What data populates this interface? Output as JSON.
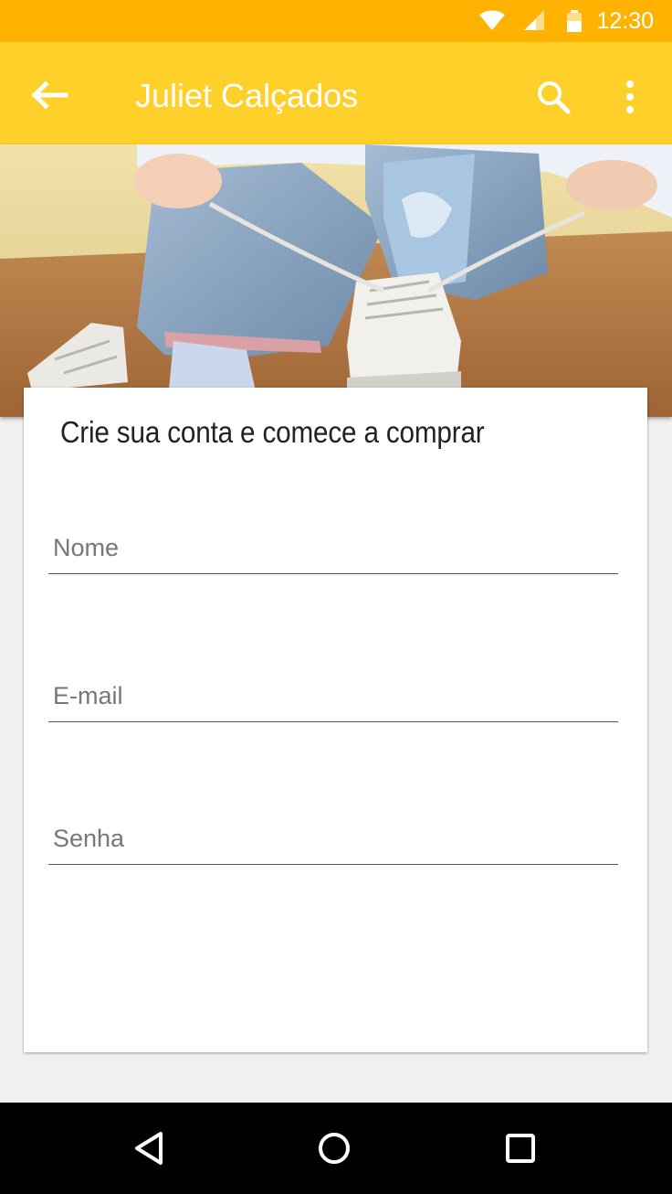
{
  "status_bar": {
    "time": "12:30",
    "icons": [
      "wifi-icon",
      "signal-icon",
      "battery-icon"
    ]
  },
  "app_bar": {
    "title": "Juliet Calçados",
    "actions": [
      "back-arrow-icon",
      "search-icon",
      "more-vert-icon"
    ],
    "color": "#ffd02a"
  },
  "form": {
    "title": "Crie sua conta e comece a comprar",
    "name_placeholder": "Nome",
    "email_placeholder": "E-mail",
    "password_placeholder": "Senha"
  },
  "nav_bar": {
    "icons": [
      "back-triangle-icon",
      "home-circle-icon",
      "recents-square-icon"
    ]
  },
  "colors": {
    "status_bar": "#ffb300",
    "app_bar": "#ffd02a",
    "background": "#f0f0f0"
  }
}
